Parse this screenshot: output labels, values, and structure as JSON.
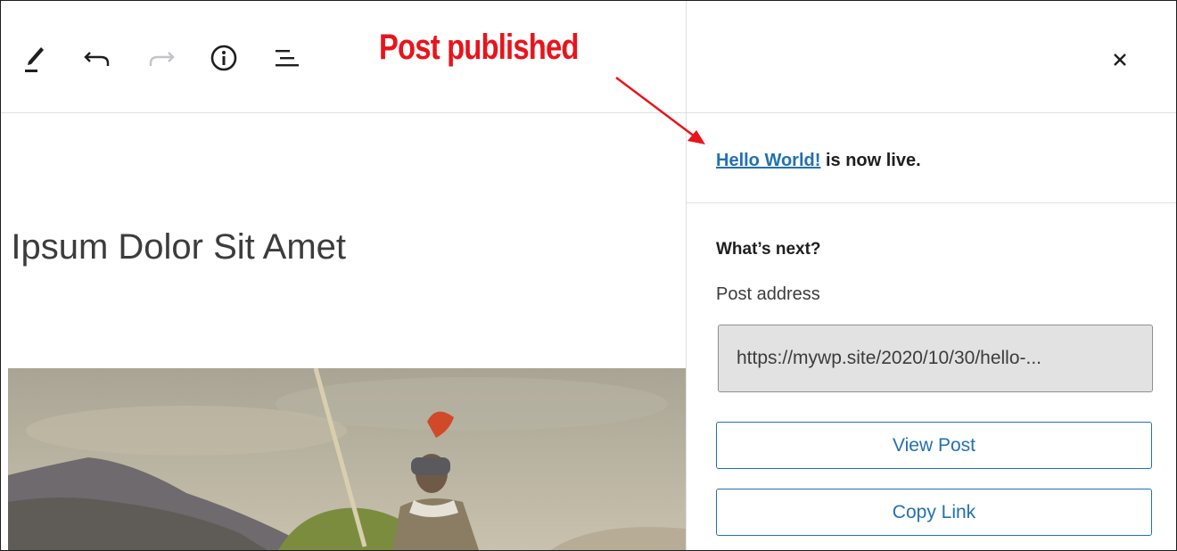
{
  "toolbar": {
    "icons": [
      "pencil-icon",
      "undo-icon",
      "redo-icon",
      "info-icon",
      "list-view-icon"
    ]
  },
  "annotation": {
    "callout_text": "Post published",
    "callout_color": "#e8141c"
  },
  "editor": {
    "post_title": "n Ipsum Dolor Sit Amet"
  },
  "sidebar": {
    "close_icon": "close-icon",
    "live_link": "Hello World!",
    "live_suffix": " is now live.",
    "next_heading": "What’s next?",
    "address_label": "Post address",
    "address_value": "https://mywp.site/2020/10/30/hello-...",
    "view_post_label": "View Post",
    "copy_link_label": "Copy Link"
  },
  "colors": {
    "accent": "#2271b1",
    "text": "#1e1e1e",
    "input_bg": "#e2e2e2"
  }
}
